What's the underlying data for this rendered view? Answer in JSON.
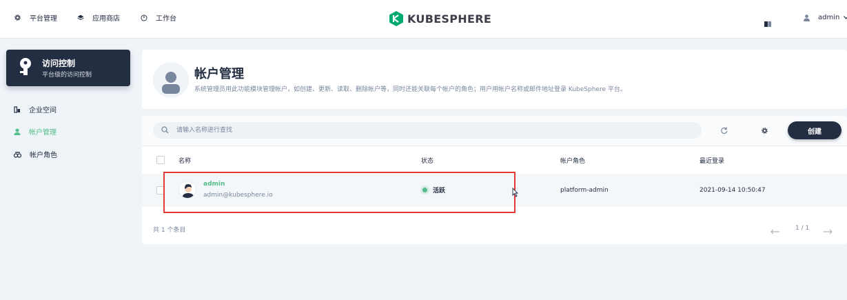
{
  "topbar": {
    "nav": [
      {
        "label": "平台管理",
        "icon": "gear-icon"
      },
      {
        "label": "应用商店",
        "icon": "cube-icon"
      },
      {
        "label": "工作台",
        "icon": "dashboard-icon"
      }
    ],
    "logo_text": "KUBESPHERE",
    "user_name": "admin"
  },
  "sidebar": {
    "card_title": "访问控制",
    "card_desc": "平台级的访问控制",
    "items": [
      {
        "label": "企业空间",
        "icon": "workspace-icon"
      },
      {
        "label": "帐户管理",
        "icon": "user-icon"
      },
      {
        "label": "帐户角色",
        "icon": "roles-icon"
      }
    ]
  },
  "header": {
    "title": "帐户管理",
    "description": "系统管理员用此功能模块管理帐户，如创建、更新、读取、删除帐户等，同时还能关联每个帐户的角色；用户用帐户名称或邮件地址登录 KubeSphere 平台。"
  },
  "toolbar": {
    "search_placeholder": "请输入名称进行查找",
    "create_label": "创建"
  },
  "table": {
    "columns": [
      "名称",
      "状态",
      "帐户角色",
      "最近登录"
    ],
    "rows": [
      {
        "name": "admin",
        "email": "admin@kubesphere.io",
        "status": "活跃",
        "role": "platform-admin",
        "last_login": "2021-09-14 10:50:47"
      }
    ]
  },
  "footer": {
    "total": "共 1 个条目",
    "page": "1 / 1"
  },
  "colors": {
    "accent": "#55bc8a",
    "dark": "#242e42",
    "highlight": "#e53935"
  }
}
